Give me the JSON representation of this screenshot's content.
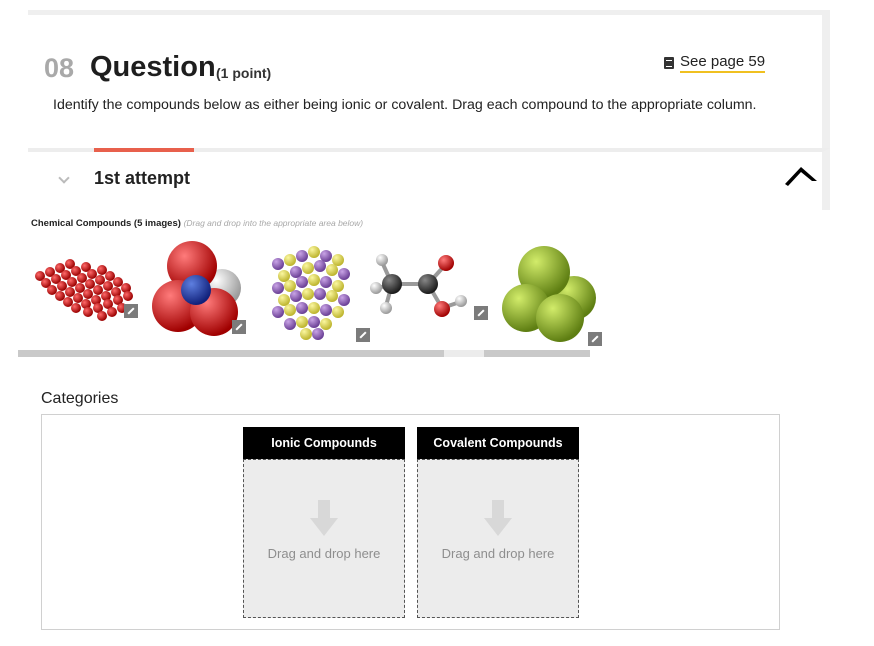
{
  "question": {
    "number": "08",
    "title": "Question",
    "points": "(1 point)",
    "text": "Identify the compounds below as either being ionic or covalent. Drag each compound to the appropriate column.",
    "see_page": "See page 59"
  },
  "attempt": {
    "label": "1st attempt"
  },
  "compounds": {
    "label": "Chemical Compounds (5 images)",
    "hint": "(Drag and drop into the appropriate area below)",
    "items": [
      {
        "icon": "red-lattice-molecule-image"
      },
      {
        "icon": "space-filling-molecule-image"
      },
      {
        "icon": "purple-yellow-crystal-image"
      },
      {
        "icon": "ball-and-stick-molecule-image"
      },
      {
        "icon": "green-spheres-molecule-image"
      }
    ]
  },
  "categories": {
    "label": "Categories",
    "columns": [
      {
        "title": "Ionic Compounds",
        "drop_text": "Drag and drop here"
      },
      {
        "title": "Covalent Compounds",
        "drop_text": "Drag and drop here"
      }
    ]
  },
  "colors": {
    "accent": "#e8604c",
    "link_underline": "#f0c020",
    "header_bg": "#000000",
    "drop_bg": "#ececec"
  }
}
